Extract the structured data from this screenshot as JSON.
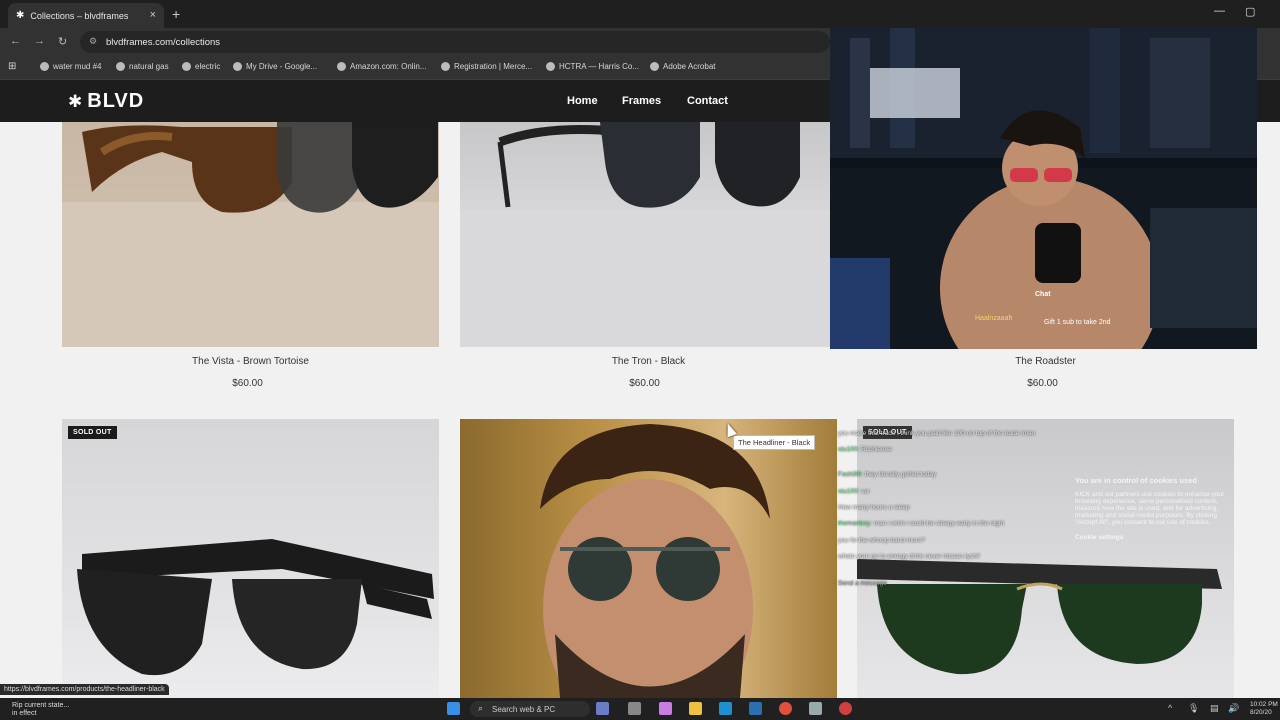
{
  "browser": {
    "tab_title": "Collections – blvdframes",
    "tab_close": "×",
    "new_tab": "+",
    "url": "blvdframes.com/collections",
    "window_controls": [
      "—",
      "▢"
    ],
    "bookmarks": [
      "water mud #4",
      "natural gas",
      "electric",
      "My Drive - Google...",
      "Amazon.com: Onlin...",
      "Registration | Merce...",
      "HCTRA — Harris Co...",
      "Adobe Acrobat"
    ],
    "status_url": "https://blvdframes.com/products/the-headliner-black"
  },
  "site": {
    "logo": "BLVD",
    "menu": [
      "Home",
      "Frames",
      "Contact"
    ]
  },
  "products": [
    {
      "title": "The Vista - Brown Tortoise",
      "price": "$60.00"
    },
    {
      "title": "The Tron - Black",
      "price": "$60.00"
    },
    {
      "title": "The Roadster",
      "price": "$60.00"
    }
  ],
  "row2": {
    "badge": "SOLD OUT",
    "badge2": "SOLD OUT"
  },
  "tooltip": "The Headliner - Black",
  "stream_overlay": {
    "chat_label": "Chat",
    "gift_user": "Haalnzaaah",
    "gift_text": "Gift 1 sub to take 2nd"
  },
  "chat_lines": [
    {
      "user": "",
      "text": "you make that trade i think you paid like 100 on top of the trade imao"
    },
    {
      "user": "stu100:",
      "text": "Ritchieeee"
    },
    {
      "user": "Fashi99:",
      "text": "they literally golfed today"
    },
    {
      "user": "stu100:",
      "text": "sui"
    },
    {
      "user": "",
      "text": "How many hours u sleep"
    },
    {
      "user": "themanboy:",
      "text": "man i wish i could be sleepy early in the night"
    },
    {
      "user": "",
      "text": "you fw the whoop band more?"
    },
    {
      "user": "",
      "text": "whats your go to energy drink never misses lyshi!"
    },
    {
      "user": "",
      "text": "Send a message"
    }
  ],
  "cookie_banner": {
    "heading": "You are in control of cookies used",
    "body": "KICK and our partners use cookies to enhance your browsing experience, serve personalised content, measure how the site is used, and for advertising, marketing and social media purposes. By clicking \"Accept All\", you consent to our use of cookies.",
    "settings": "Cookie settings"
  },
  "taskbar": {
    "notification_title": "Rip current state...",
    "notification_sub": "in effect",
    "search_placeholder": "Search web & PC",
    "time": "10:02 PM",
    "date": "8/20/20"
  },
  "colors": {
    "site_nav": "#1d1d1d",
    "page_bg": "#f1f1f1",
    "chat_user": "#6fd68b"
  }
}
